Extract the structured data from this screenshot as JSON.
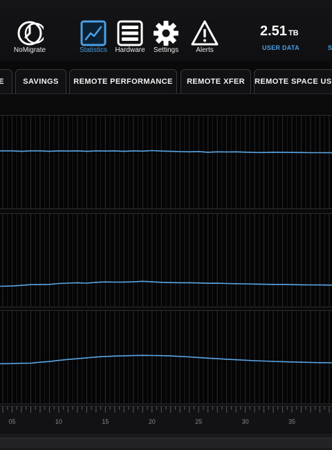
{
  "toolbar": {
    "items": [
      {
        "label": "NoMigrate",
        "icon": "nomigrate-icon",
        "active": false
      },
      {
        "label": "Statistics",
        "icon": "statistics-icon",
        "active": true
      },
      {
        "label": "Hardware",
        "icon": "hardware-icon",
        "active": false
      },
      {
        "label": "Settings",
        "icon": "settings-icon",
        "active": false
      },
      {
        "label": "Alerts",
        "icon": "alerts-icon",
        "active": false
      }
    ],
    "user_data": {
      "value": "2.51",
      "unit": "TB",
      "label": "USER DATA"
    },
    "edge_label_fragment": "S"
  },
  "tabs": [
    {
      "label": "E"
    },
    {
      "label": "SAVINGS"
    },
    {
      "label": "REMOTE PERFORMANCE"
    },
    {
      "label": "REMOTE XFER"
    },
    {
      "label": "REMOTE SPACE USA"
    }
  ],
  "colors": {
    "accent": "#4b9fe3",
    "line": "#5aa7e6",
    "background": "#0a0a0b",
    "grid": "#2a2a2e"
  },
  "chart_data": {
    "type": "line",
    "x_tick_labels": [
      "05",
      "10",
      "15",
      "20",
      "25",
      "30",
      "35"
    ],
    "x_ticks": [
      5,
      10,
      15,
      20,
      25,
      30,
      35
    ],
    "xlim": [
      3.7,
      39.3
    ],
    "panels": [
      {
        "ylim": [
          0,
          100
        ],
        "x": [
          3.7,
          5,
          6,
          7,
          8,
          9,
          10,
          11,
          12,
          13,
          14,
          15,
          16,
          17,
          18,
          19,
          20,
          21,
          22,
          23,
          24,
          25,
          26,
          27,
          28,
          29,
          30,
          31,
          32,
          33,
          34,
          35,
          36,
          37,
          38,
          39.3
        ],
        "values": [
          62,
          62,
          61.5,
          62,
          62,
          61.5,
          62,
          61.8,
          62,
          61.5,
          62,
          61.8,
          62,
          61.5,
          62,
          61.7,
          62.3,
          61.8,
          61.5,
          61.2,
          61,
          61.3,
          60.5,
          61,
          60.8,
          61,
          60.6,
          60.3,
          60.2,
          60.5,
          60.4,
          60.3,
          60.2,
          60.1,
          60.1,
          60
        ]
      },
      {
        "ylim": [
          0,
          100
        ],
        "x": [
          3.7,
          5,
          6,
          7,
          8,
          9,
          10,
          11,
          12,
          13,
          14,
          15,
          16,
          17,
          18,
          19,
          20,
          21,
          22,
          23,
          24,
          25,
          26,
          27,
          28,
          29,
          30,
          31,
          32,
          33,
          34,
          35,
          36,
          37,
          38,
          39.3
        ],
        "values": [
          22,
          22.3,
          23,
          23.8,
          23.8,
          24,
          25,
          25.4,
          25.8,
          25.4,
          26.3,
          26.7,
          26.5,
          26.6,
          26.8,
          27.4,
          26.8,
          26.3,
          26,
          25.8,
          25.8,
          25.6,
          25.2,
          25.3,
          25,
          24.8,
          24.6,
          24.4,
          24.2,
          24,
          24,
          23.8,
          23.6,
          23.5,
          23.4,
          23.3
        ]
      },
      {
        "ylim": [
          0,
          100
        ],
        "x": [
          3.7,
          5,
          6,
          7,
          8,
          9,
          10,
          11,
          12,
          13,
          14,
          15,
          16,
          17,
          18,
          19,
          20,
          21,
          22,
          23,
          24,
          25,
          26,
          27,
          28,
          29,
          30,
          31,
          32,
          33,
          34,
          35,
          36,
          37,
          38,
          39.3
        ],
        "values": [
          43,
          43.1,
          43.5,
          43.6,
          44.6,
          45.4,
          46.6,
          47.6,
          48.4,
          49.3,
          50.2,
          50.8,
          51.3,
          51.6,
          51.8,
          52,
          51.9,
          51.7,
          51.4,
          50.9,
          50.4,
          49.7,
          49,
          48.4,
          47.8,
          47.3,
          46.8,
          46.3,
          45.9,
          45.5,
          45.2,
          44.9,
          44.6,
          44.4,
          44.2,
          44
        ]
      }
    ]
  }
}
